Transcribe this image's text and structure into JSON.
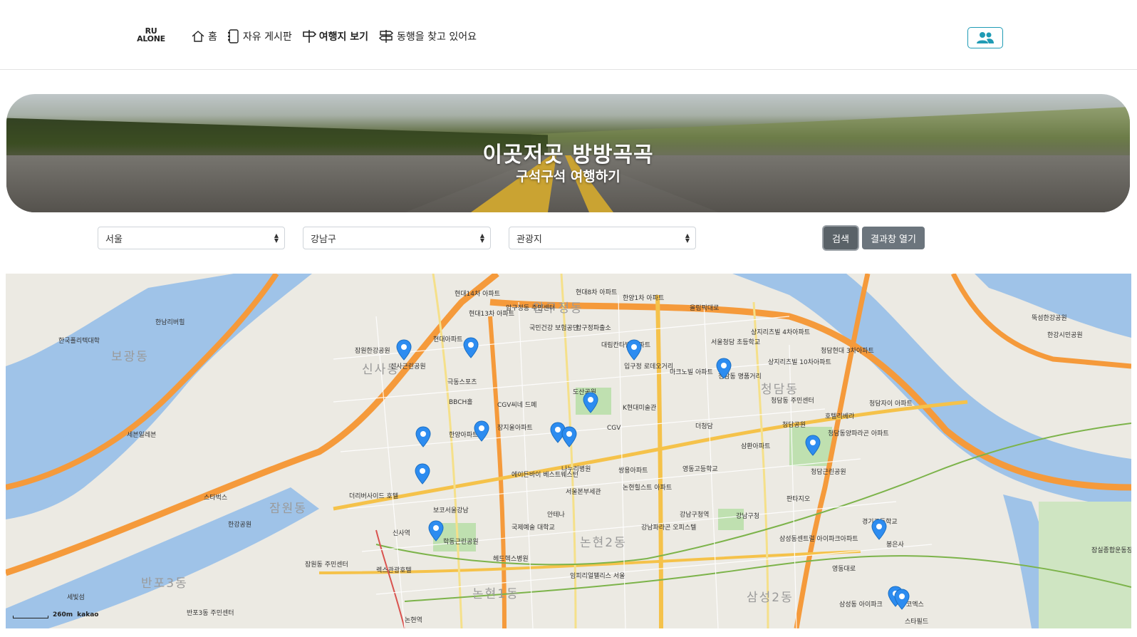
{
  "logo": {
    "line1": "RU",
    "line2": "ALONE"
  },
  "nav": {
    "items": [
      {
        "label": "홈",
        "icon": "home-icon",
        "active": false
      },
      {
        "label": "자유 게시판",
        "icon": "board-icon",
        "active": false
      },
      {
        "label": "여행지 보기",
        "icon": "signpost-icon",
        "active": true
      },
      {
        "label": "동행을 찾고 있어요",
        "icon": "signpost-split-icon",
        "active": false
      }
    ],
    "user_button_icon": "people-icon",
    "accent": "#1f9bb5"
  },
  "banner": {
    "title": "이곳저곳 방방곡곡",
    "subtitle": "구석구석 여행하기"
  },
  "filters": {
    "region": "서울",
    "district": "강남구",
    "category": "관광지",
    "search_label": "검색",
    "result_label": "결과창 열기"
  },
  "map": {
    "provider": "kakao",
    "scale_label": "260m",
    "area_labels": [
      "보광동",
      "압구정동",
      "신사동",
      "잠원동",
      "반포3동",
      "논현1동",
      "논현2동",
      "삼성2동",
      "청담동"
    ],
    "place_labels": [
      "한남리버힐",
      "현대14차 아파트",
      "현대13차 아파트",
      "압구정동 주민센터",
      "국민건강 보험공단",
      "압구정파출소",
      "현대8차 아파트",
      "한양1차 아파트",
      "신사근린공원",
      "잠원한강공원",
      "현대아파트",
      "극동스포츠",
      "BBCH홀",
      "CGV씨네 드페",
      "한양아파트",
      "장지울아파트",
      "도산공원",
      "K현대미술관",
      "CGV",
      "입구정 로데오거리",
      "대림칸타빌 아파트",
      "마크노빌 아파트",
      "청담동 명품거리",
      "상지리츠빌 4차아파트",
      "서울청담 초등학교",
      "청담현대 3차아파트",
      "상지리츠빌 10차아파트",
      "청담동 주민센터",
      "호텔리베라",
      "청담자이 아파트",
      "청담동양파라곤 아파트",
      "청담공원",
      "더청담",
      "삼환아파트",
      "영동고등학교",
      "나누리병원",
      "서울본부세관",
      "에이든바이 베스트웨스턴",
      "쌍용아파트",
      "논현힐스트 아파트",
      "보코서울강남",
      "신사역",
      "학동근린공원",
      "더리버사이드 호텔",
      "한강공원",
      "스타벅스",
      "강남구청역",
      "강남구청",
      "강남파라곤 오피스텔",
      "판타지오",
      "삼성동센트럴 아이파크아파트",
      "경기고등학교",
      "봉은사",
      "스타필드",
      "코엑스",
      "삼성동 아이파크",
      "논현역",
      "잠원동 주민센터",
      "반포3동 주민센터",
      "한국폴리텍대학",
      "세빛섬",
      "세븐일레븐",
      "뚝섬한강공원",
      "한강시민공원",
      "잠실종합운동장",
      "청담근린공원",
      "임피리얼팰리스 서울",
      "렉스관광호텔",
      "헤드헥스병원",
      "국제예술 대학교",
      "안테나",
      "영동대로",
      "올림픽대로"
    ],
    "marker_color": "#2d8cf0"
  }
}
